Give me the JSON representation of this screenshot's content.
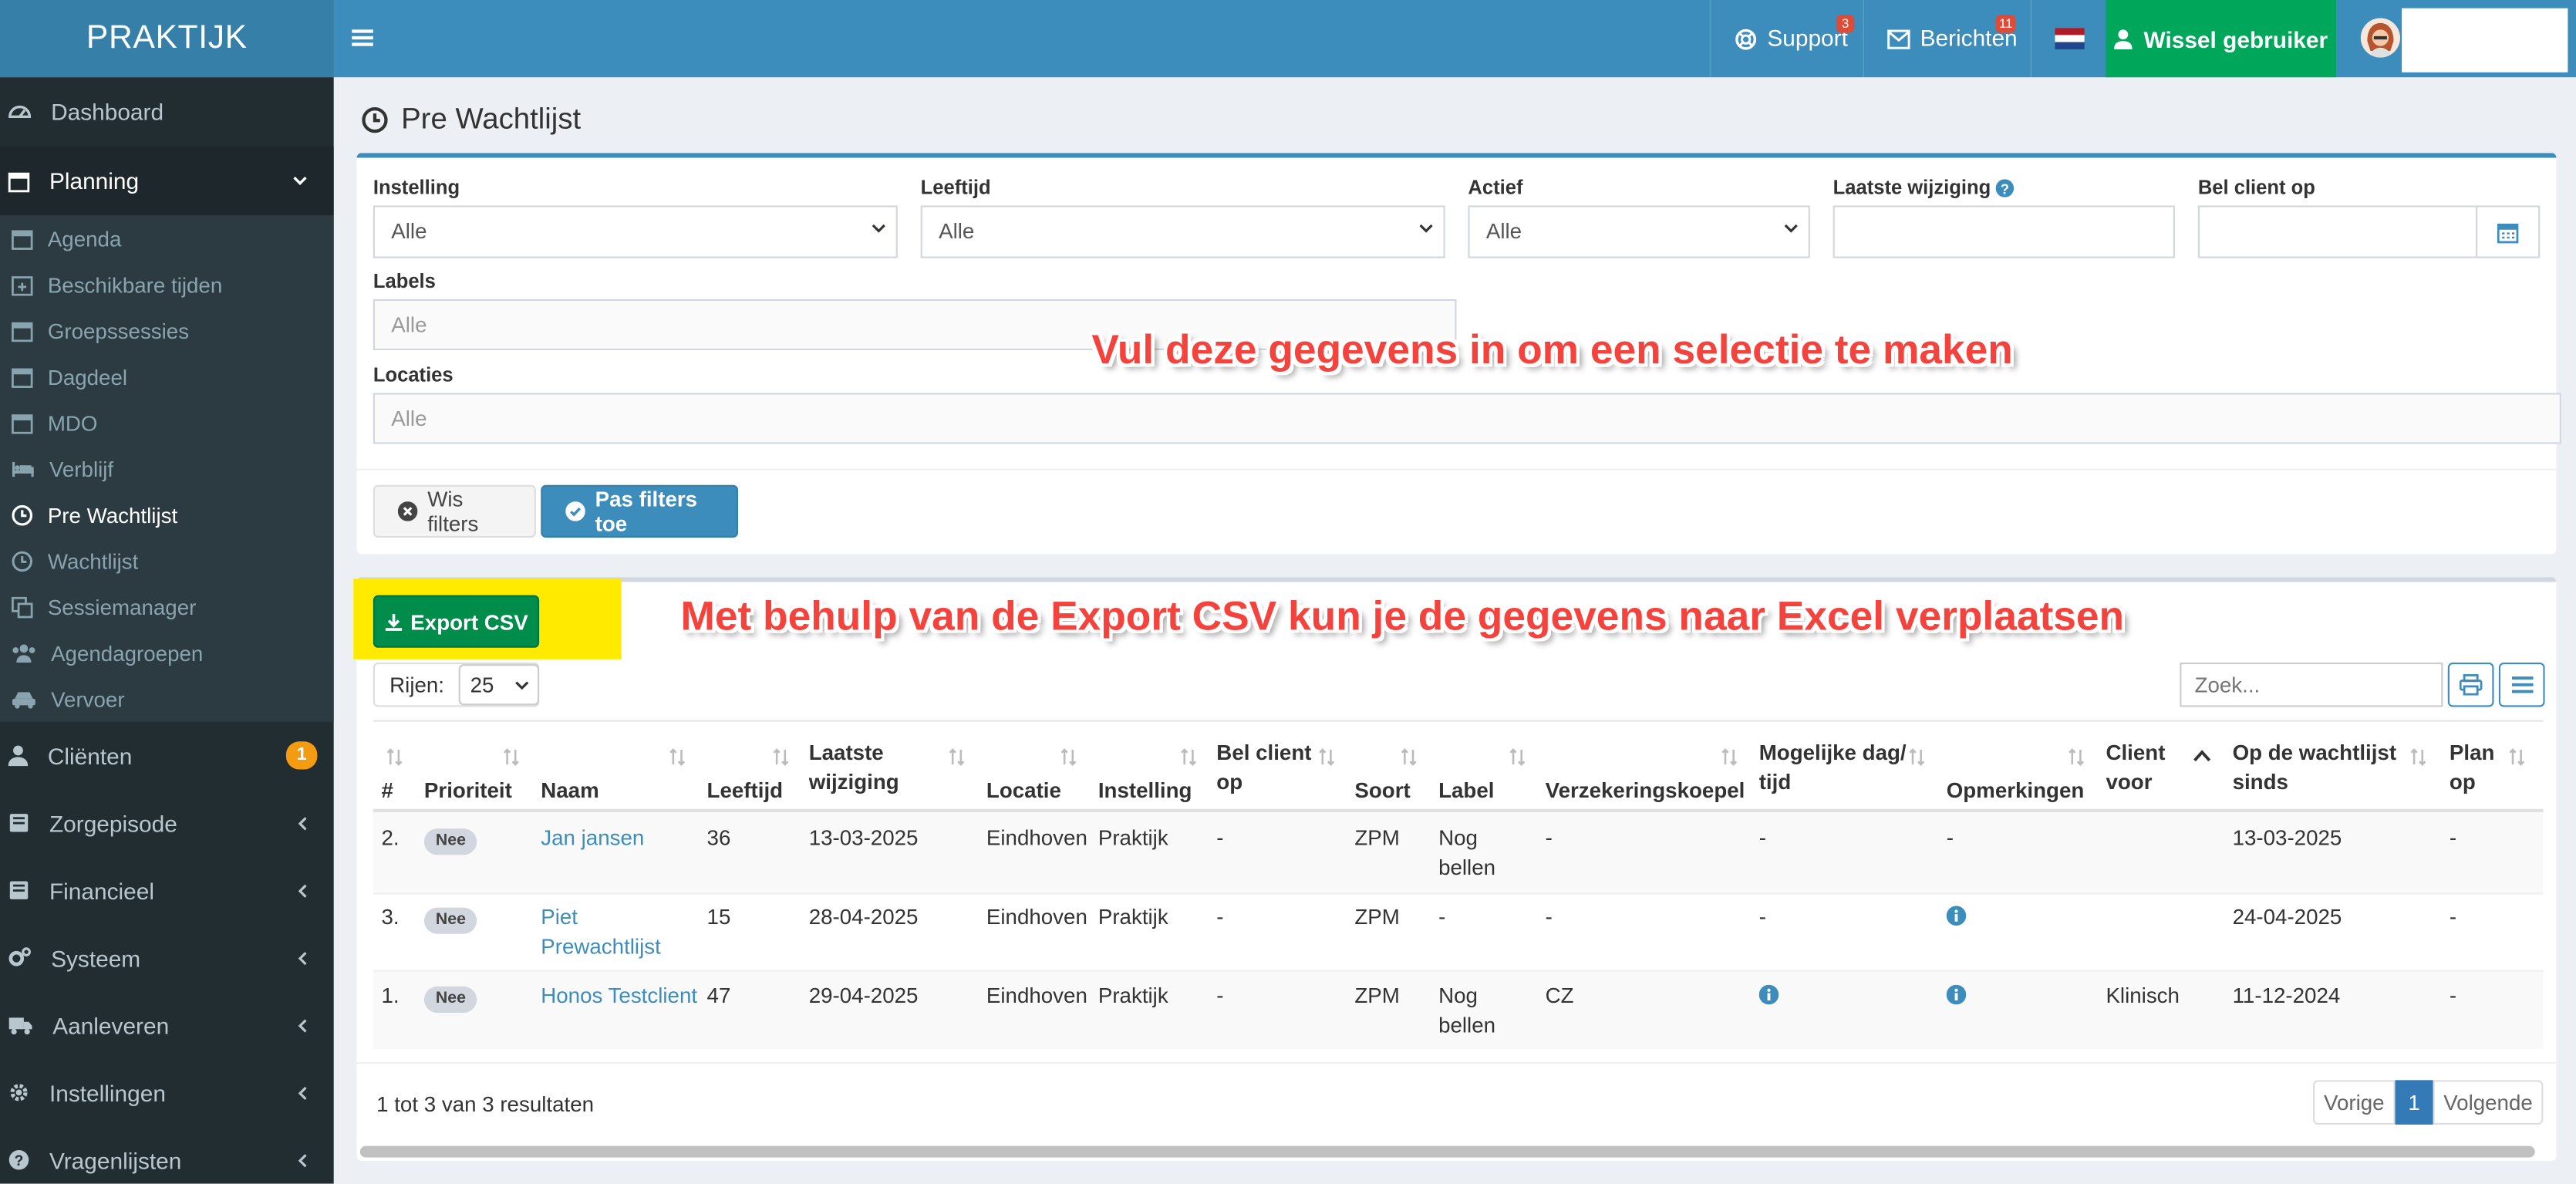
{
  "app": {
    "logo": "PRAKTIJK"
  },
  "header": {
    "support_label": "Support",
    "support_count": "3",
    "messages_label": "Berichten",
    "messages_count": "11",
    "switch_user_label": "Wissel gebruiker",
    "colors": {
      "header": "#3c8dbc",
      "switch": "#00a65a"
    }
  },
  "sidebar": {
    "dashboard": "Dashboard",
    "planning": "Planning",
    "planning_items": [
      "Agenda",
      "Beschikbare tijden",
      "Groepssessies",
      "Dagdeel",
      "MDO",
      "Verblijf",
      "Pre Wachtlijst",
      "Wachtlijst",
      "Sessiemanager",
      "Agendagroepen",
      "Vervoer"
    ],
    "clients": "Cliënten",
    "clients_badge": "1",
    "zorgepisode": "Zorgepisode",
    "financieel": "Financieel",
    "systeem": "Systeem",
    "aanleveren": "Aanleveren",
    "instellingen": "Instellingen",
    "vragenlijsten": "Vragenlijsten"
  },
  "page": {
    "title": "Pre Wachtlijst"
  },
  "filters": {
    "instelling_label": "Instelling",
    "instelling_value": "Alle",
    "leeftijd_label": "Leeftijd",
    "leeftijd_value": "Alle",
    "actief_label": "Actief",
    "actief_value": "Alle",
    "laatste_wijziging_label": "Laatste wijziging",
    "bel_client_op_label": "Bel client op",
    "labels_label": "Labels",
    "labels_placeholder": "Alle",
    "locaties_label": "Locaties",
    "locaties_placeholder": "Alle",
    "clear_button": "Wis filters",
    "apply_button": "Pas filters toe"
  },
  "annotations": {
    "filters_hint": "Vul deze gegevens in om een selectie te maken",
    "export_hint": "Met behulp van de Export CSV kun je de gegevens naar Excel verplaatsen"
  },
  "table_tools": {
    "export_button": "Export CSV",
    "rows_label": "Rijen:",
    "rows_value": "25",
    "search_placeholder": "Zoek..."
  },
  "table": {
    "headers": {
      "nr": "#",
      "prioriteit": "Prioriteit",
      "naam": "Naam",
      "leeftijd": "Leeftijd",
      "laatste_wijziging_1": "Laatste",
      "laatste_wijziging_2": "wijziging",
      "locatie": "Locatie",
      "instelling": "Instelling",
      "bel_1": "Bel client",
      "bel_2": "op",
      "soort": "Soort",
      "label": "Label",
      "verzekeringskoepel": "Verzekeringskoepel",
      "mogelijke_1": "Mogelijke dag/",
      "mogelijke_2": "tijd",
      "opmerkingen": "Opmerkingen",
      "client_voor_1": "Client",
      "client_voor_2": "voor",
      "op_wachtlijst_1": "Op de wachtlijst",
      "op_wachtlijst_2": "sinds",
      "plan_1": "Plan",
      "plan_2": "op"
    },
    "rows": [
      {
        "nr": "2.",
        "prioriteit": "Nee",
        "naam": "Jan jansen",
        "naam_2": "",
        "leeftijd": "36",
        "laatste_wijziging": "13-03-2025",
        "locatie": "Eindhoven",
        "instelling": "Praktijk",
        "bel": "-",
        "soort": "ZPM",
        "label_1": "Nog",
        "label_2": "bellen",
        "verzekeringskoepel": "-",
        "mogelijke": "-",
        "opmerkingen": "-",
        "client_voor": "",
        "op_wachtlijst": "13-03-2025",
        "plan": "-"
      },
      {
        "nr": "3.",
        "prioriteit": "Nee",
        "naam": "Piet",
        "naam_2": "Prewachtlijst",
        "leeftijd": "15",
        "laatste_wijziging": "28-04-2025",
        "locatie": "Eindhoven",
        "instelling": "Praktijk",
        "bel": "-",
        "soort": "ZPM",
        "label_1": "-",
        "label_2": "",
        "verzekeringskoepel": "-",
        "mogelijke": "-",
        "opmerkingen": "info-icon",
        "client_voor": "",
        "op_wachtlijst": "24-04-2025",
        "plan": "-"
      },
      {
        "nr": "1.",
        "prioriteit": "Nee",
        "naam": "Honos Testclient",
        "naam_2": "",
        "leeftijd": "47",
        "laatste_wijziging": "29-04-2025",
        "locatie": "Eindhoven",
        "instelling": "Praktijk",
        "bel": "-",
        "soort": "ZPM",
        "label_1": "Nog",
        "label_2": "bellen",
        "verzekeringskoepel": "CZ",
        "mogelijke": "info-icon",
        "opmerkingen": "info-icon",
        "client_voor": "Klinisch",
        "op_wachtlijst": "11-12-2024",
        "plan": "-"
      }
    ]
  },
  "footer": {
    "summary": "1 tot 3 van 3 resultaten",
    "prev": "Vorige",
    "page": "1",
    "next": "Volgende"
  }
}
